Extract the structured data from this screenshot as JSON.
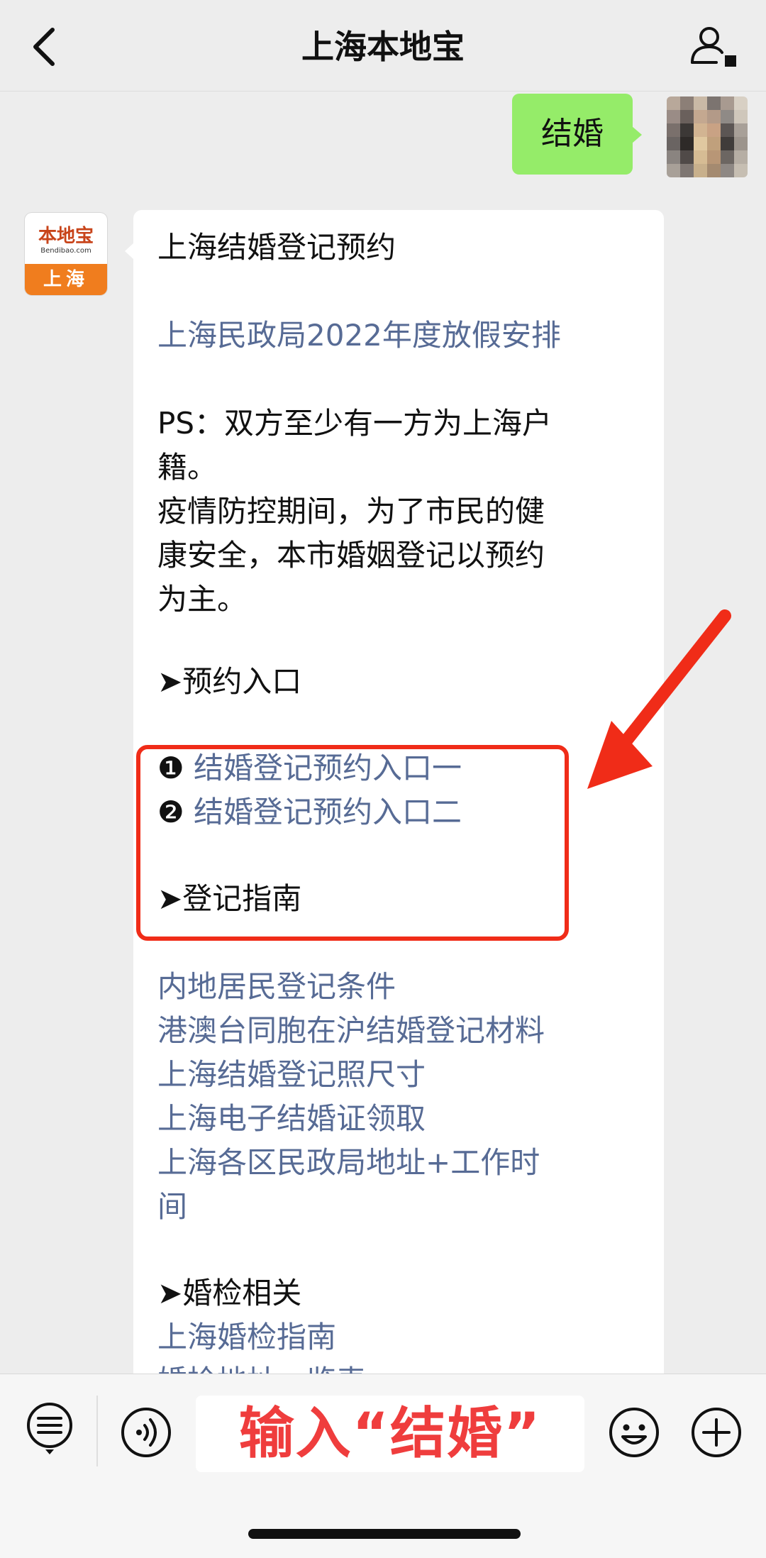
{
  "nav": {
    "title": "上海本地宝"
  },
  "sent_message": {
    "text": "结婚"
  },
  "bot": {
    "avatar_logo": "本地宝",
    "avatar_url": "Bendibao.com",
    "avatar_city": "上海"
  },
  "reply": {
    "title": "上海结婚登记预约",
    "holiday_link": "上海民政局2022年度放假安排",
    "ps_line1": "PS：双方至少有一方为上海户",
    "ps_line2": "籍。",
    "epi_line1": "疫情防控期间，为了市民的健",
    "epi_line2": "康安全，本市婚姻登记以预约",
    "epi_line3": "为主。",
    "booking": {
      "heading": "➤预约入口",
      "items": [
        {
          "num": "❶",
          "label": "结婚登记预约入口一"
        },
        {
          "num": "❷",
          "label": "结婚登记预约入口二"
        }
      ]
    },
    "guide": {
      "heading": "➤登记指南",
      "links": [
        "内地居民登记条件",
        "港澳台同胞在沪结婚登记材料",
        "上海结婚登记照尺寸",
        "上海电子结婚证领取",
        "上海各区民政局地址+工作时",
        "间"
      ]
    },
    "exam": {
      "heading": "➤婚检相关",
      "links": [
        "上海婚检指南",
        "婚检地址一览表"
      ]
    }
  },
  "input": {
    "text": "输入“结婚”"
  },
  "colors": {
    "sent_bubble": "#95ec69",
    "link": "#576b95",
    "highlight": "#f02c18",
    "annotation_text": "#ef3d3d",
    "brand_orange": "#f07d1e"
  },
  "icons": {
    "back": "chevron-left-icon",
    "profile": "user-icon",
    "menu": "list-menu-icon",
    "voice": "voice-icon",
    "emoji": "emoji-icon",
    "more": "plus-icon",
    "annotation": "red-arrow-icon"
  }
}
